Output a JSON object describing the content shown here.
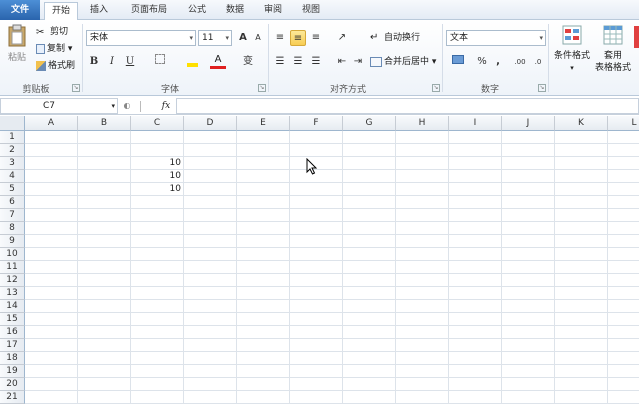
{
  "tabs": [
    "文件",
    "开始",
    "插入",
    "页面布局",
    "公式",
    "数据",
    "审阅",
    "视图"
  ],
  "clipboard": {
    "paste": "粘贴",
    "cut": "剪切",
    "copy": "复制",
    "format_painter": "格式刷",
    "label": "剪贴板"
  },
  "font": {
    "name": "宋体",
    "size": "11",
    "bold": "B",
    "italic": "I",
    "underline": "U",
    "label": "字体",
    "grow": "A",
    "shrink": "A",
    "color_a": "A",
    "wen": "变"
  },
  "alignment": {
    "wrap": "自动换行",
    "merge": "合并后居中",
    "label": "对齐方式"
  },
  "number": {
    "format": "文本",
    "percent": "%",
    "comma": ",",
    "label": "数字"
  },
  "styles": {
    "conditional": "条件格式",
    "table": "套用",
    "table2": "表格格式"
  },
  "formula_bar": {
    "name_box": "C7",
    "fx": "fx",
    "value": ""
  },
  "columns": [
    "A",
    "B",
    "C",
    "D",
    "E",
    "F",
    "G",
    "H",
    "I",
    "J",
    "K",
    "L"
  ],
  "rows": [
    "1",
    "2",
    "3",
    "4",
    "5",
    "6",
    "7",
    "8",
    "9",
    "10",
    "11",
    "12",
    "13",
    "14",
    "15",
    "16",
    "17",
    "18",
    "19",
    "20",
    "21"
  ],
  "cells": {
    "C3": "10",
    "C4": "10",
    "C5": "10"
  },
  "colors": {
    "file_tab": "#2a64ad",
    "accent": "#f8cd54",
    "grid": "#dde3ea"
  }
}
